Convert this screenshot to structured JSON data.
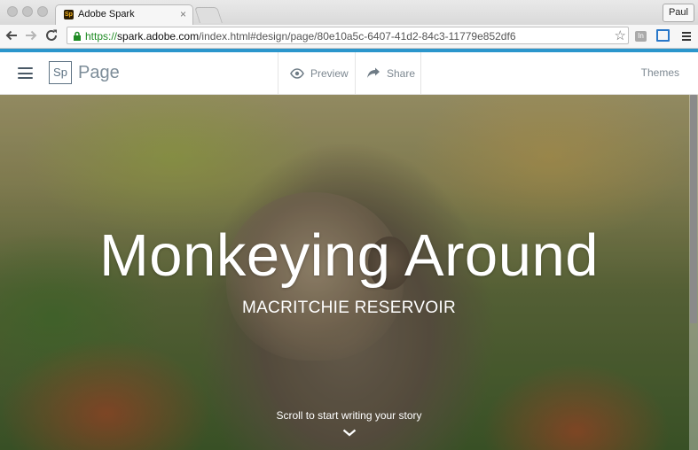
{
  "browser": {
    "tab_title": "Adobe Spark",
    "tab_favicon_text": "Sp",
    "profile_name": "Paul",
    "url_scheme": "https://",
    "url_host": "spark.adobe.com",
    "url_path": "/index.html#design/page/80e10a5c-6407-41d2-84c3-11779e852df6",
    "ext_label": "In"
  },
  "app": {
    "logo_text": "Sp",
    "product_name": "Page",
    "preview_label": "Preview",
    "share_label": "Share",
    "themes_label": "Themes"
  },
  "hero": {
    "title": "Monkeying Around",
    "subtitle": "MACRITCHIE RESERVOIR",
    "scroll_hint": "Scroll to start writing your story"
  },
  "colors": {
    "accent_bar": "#2b96cc",
    "header_text": "#7d8891"
  }
}
